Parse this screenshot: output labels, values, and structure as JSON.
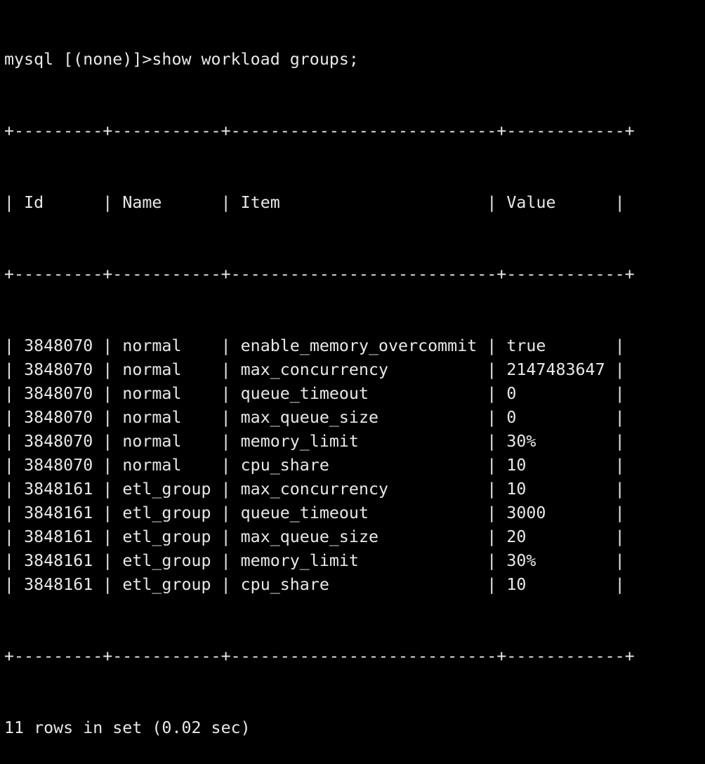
{
  "terminal": {
    "prompt": "mysql [(none)]>",
    "command": "show workload groups;",
    "border": "+---------+-----------+---------------------------+------------+",
    "columns": [
      "Id",
      "Name",
      "Item",
      "Value"
    ],
    "rows": [
      [
        "3848070",
        "normal",
        "enable_memory_overcommit",
        "true"
      ],
      [
        "3848070",
        "normal",
        "max_concurrency",
        "2147483647"
      ],
      [
        "3848070",
        "normal",
        "queue_timeout",
        "0"
      ],
      [
        "3848070",
        "normal",
        "max_queue_size",
        "0"
      ],
      [
        "3848070",
        "normal",
        "memory_limit",
        "30%"
      ],
      [
        "3848070",
        "normal",
        "cpu_share",
        "10"
      ],
      [
        "3848161",
        "etl_group",
        "max_concurrency",
        "10"
      ],
      [
        "3848161",
        "etl_group",
        "queue_timeout",
        "3000"
      ],
      [
        "3848161",
        "etl_group",
        "max_queue_size",
        "20"
      ],
      [
        "3848161",
        "etl_group",
        "memory_limit",
        "30%"
      ],
      [
        "3848161",
        "etl_group",
        "cpu_share",
        "10"
      ]
    ],
    "footer": "11 rows in set (0.02 sec)"
  },
  "colors": {
    "background": "#000000",
    "text": "#e8e8e8"
  }
}
